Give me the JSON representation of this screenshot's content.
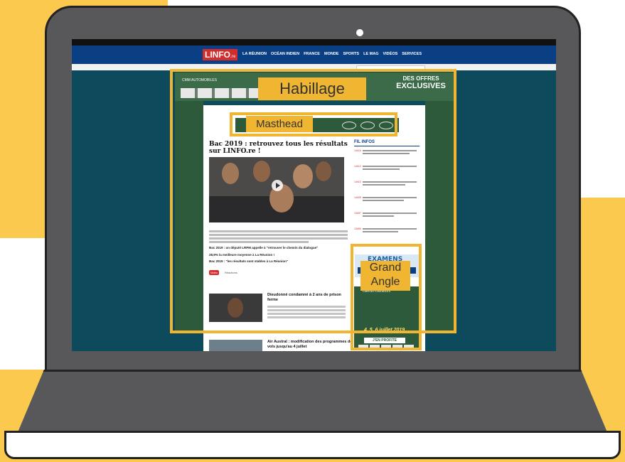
{
  "site": {
    "logo": "LINFO",
    "logo_suffix": ".re",
    "nav": [
      "LA RÉUNION",
      "OCÉAN INDIEN",
      "FRANCE",
      "MONDE",
      "SPORTS",
      "LE MAG",
      "VIDÉOS",
      "SERVICES"
    ]
  },
  "ads": {
    "habillage_brand": "CMM AUTOMOBILES",
    "habillage_offer_line1": "DES OFFRES",
    "habillage_offer_line2": "EXCLUSIVES",
    "grand_brand": "CMM AUTOMOBILES",
    "grand_dates": "4, 5, 6 juillet 2019",
    "grand_cta": "J'EN PROFITE",
    "exam_title": "EXAMENS 2019",
    "exam_cta": "RETROUVEZ VOS RÉSULTATS >"
  },
  "article": {
    "title": "Bac 2019 : retrouvez tous les résultats sur LINFO.re !",
    "related1": "Bac 2019 : un député LRPM appelle à \"retrouver le chemin du dialogue\"",
    "related2": "28,9% la meilleure moyenne à La Réunion !",
    "related3": "Bac 2019 : \"les résultats sont stables à La Réunion\"",
    "tag": "Vidéo",
    "reactions": "Réactions"
  },
  "second_article": {
    "title": "Dieudonné condamné à 2 ans de prison ferme"
  },
  "third_article": {
    "title": "Air Austral : modification des programmes de vols jusqu'au 4 juillet"
  },
  "sidebar": {
    "title": "FIL INFOS",
    "times": [
      "14h16",
      "14h12",
      "14h10",
      "14h05",
      "13h57",
      "13h50"
    ]
  },
  "annotations": {
    "habillage": "Habillage",
    "masthead": "Masthead",
    "grand_angle_line1": "Grand",
    "grand_angle_line2": "Angle"
  },
  "colors": {
    "highlight": "#f0b531",
    "site_blue": "#0b3f84",
    "site_red": "#d52c2c",
    "ad_green": "#2e5a3c",
    "page_bg": "#0d4a5c",
    "yellow_bg": "#fac94d",
    "laptop_gray": "#58585a"
  }
}
